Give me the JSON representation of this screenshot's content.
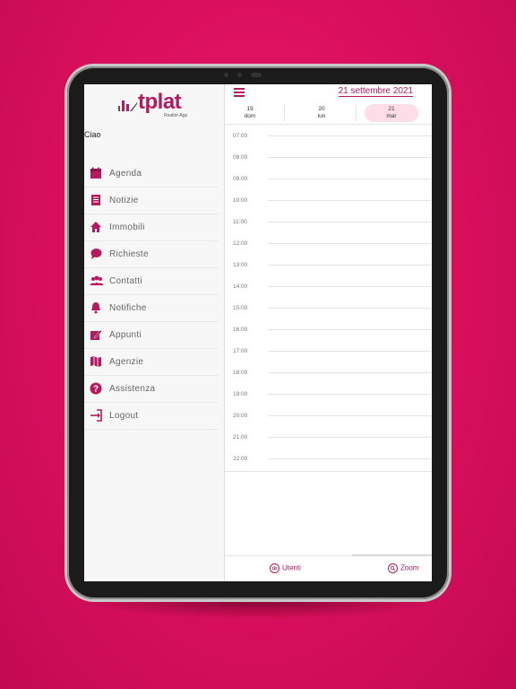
{
  "app": {
    "logo_text": "tplat",
    "logo_subtitle": "Realtor App",
    "greeting": "Ciao",
    "accent_color": "#b6195e"
  },
  "sidebar": {
    "items": [
      {
        "label": "Agenda",
        "icon": "calendar-icon"
      },
      {
        "label": "Notizie",
        "icon": "news-icon"
      },
      {
        "label": "Immobili",
        "icon": "home-icon"
      },
      {
        "label": "Richieste",
        "icon": "chat-bubble-icon"
      },
      {
        "label": "Contatti",
        "icon": "contacts-icon"
      },
      {
        "label": "Notifiche",
        "icon": "bell-icon"
      },
      {
        "label": "Appunti",
        "icon": "note-edit-icon"
      },
      {
        "label": "Agenzie",
        "icon": "map-icon"
      },
      {
        "label": "Assistenza",
        "icon": "help-icon"
      },
      {
        "label": "Logout",
        "icon": "logout-icon"
      }
    ]
  },
  "calendar": {
    "title": "21 settembre 2021",
    "days": [
      {
        "num": "19",
        "name": "dom",
        "selected": false
      },
      {
        "num": "20",
        "name": "lun",
        "selected": false
      },
      {
        "num": "21",
        "name": "mar",
        "selected": true
      }
    ],
    "hours": [
      "07:00",
      "08:00",
      "09:00",
      "10:00",
      "11:00",
      "12:00",
      "13:00",
      "14:00",
      "15:00",
      "16:00",
      "17:00",
      "18:00",
      "19:00",
      "20:00",
      "21:00",
      "22:00"
    ]
  },
  "footer": {
    "users_label": "Utenti",
    "zoom_label": "Zoom"
  }
}
